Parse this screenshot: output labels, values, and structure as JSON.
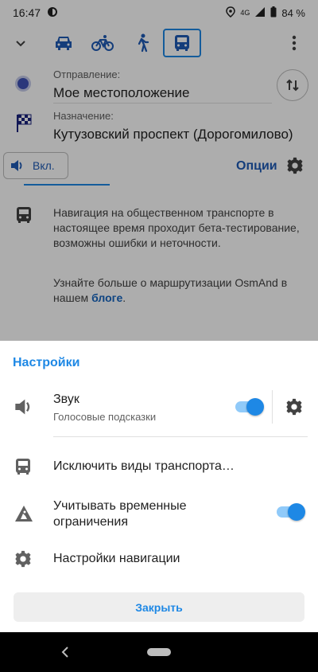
{
  "status": {
    "time": "16:47",
    "network": "4G",
    "battery": "84 %"
  },
  "route": {
    "from_label": "Отправление:",
    "from_value": "Мое местоположение",
    "to_label": "Назначение:",
    "to_value": "Кутузовский проспект (Дорогомилово)"
  },
  "toolbar": {
    "sound_label": "Вкл.",
    "options_label": "Опции"
  },
  "info": {
    "text": "Навигация на общественном транспорте в настоящее время проходит бета-тестирование, возможны ошибки и неточности.",
    "more_prefix": "Узнайте больше о маршрутизации OsmAnd в нашем ",
    "more_link": "блоге",
    "more_suffix": "."
  },
  "sheet": {
    "title": "Настройки",
    "sound_title": "Звук",
    "sound_sub": "Голосовые подсказки",
    "exclude_transport": "Исключить виды транспорта…",
    "temp_restrictions": "Учитывать временные ограничения",
    "nav_settings": "Настройки навигации",
    "close_label": "Закрыть"
  },
  "colors": {
    "accent": "#1e88e5",
    "link": "#1e5bb5"
  }
}
